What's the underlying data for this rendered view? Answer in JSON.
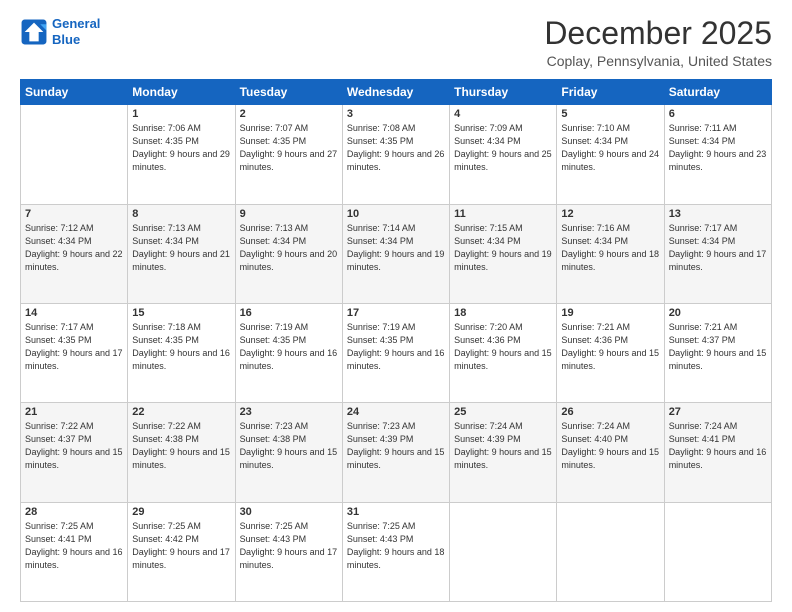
{
  "header": {
    "logo_line1": "General",
    "logo_line2": "Blue",
    "title": "December 2025",
    "subtitle": "Coplay, Pennsylvania, United States"
  },
  "weekdays": [
    "Sunday",
    "Monday",
    "Tuesday",
    "Wednesday",
    "Thursday",
    "Friday",
    "Saturday"
  ],
  "weeks": [
    [
      {
        "day": "",
        "sunrise": "",
        "sunset": "",
        "daylight": ""
      },
      {
        "day": "1",
        "sunrise": "Sunrise: 7:06 AM",
        "sunset": "Sunset: 4:35 PM",
        "daylight": "Daylight: 9 hours and 29 minutes."
      },
      {
        "day": "2",
        "sunrise": "Sunrise: 7:07 AM",
        "sunset": "Sunset: 4:35 PM",
        "daylight": "Daylight: 9 hours and 27 minutes."
      },
      {
        "day": "3",
        "sunrise": "Sunrise: 7:08 AM",
        "sunset": "Sunset: 4:35 PM",
        "daylight": "Daylight: 9 hours and 26 minutes."
      },
      {
        "day": "4",
        "sunrise": "Sunrise: 7:09 AM",
        "sunset": "Sunset: 4:34 PM",
        "daylight": "Daylight: 9 hours and 25 minutes."
      },
      {
        "day": "5",
        "sunrise": "Sunrise: 7:10 AM",
        "sunset": "Sunset: 4:34 PM",
        "daylight": "Daylight: 9 hours and 24 minutes."
      },
      {
        "day": "6",
        "sunrise": "Sunrise: 7:11 AM",
        "sunset": "Sunset: 4:34 PM",
        "daylight": "Daylight: 9 hours and 23 minutes."
      }
    ],
    [
      {
        "day": "7",
        "sunrise": "Sunrise: 7:12 AM",
        "sunset": "Sunset: 4:34 PM",
        "daylight": "Daylight: 9 hours and 22 minutes."
      },
      {
        "day": "8",
        "sunrise": "Sunrise: 7:13 AM",
        "sunset": "Sunset: 4:34 PM",
        "daylight": "Daylight: 9 hours and 21 minutes."
      },
      {
        "day": "9",
        "sunrise": "Sunrise: 7:13 AM",
        "sunset": "Sunset: 4:34 PM",
        "daylight": "Daylight: 9 hours and 20 minutes."
      },
      {
        "day": "10",
        "sunrise": "Sunrise: 7:14 AM",
        "sunset": "Sunset: 4:34 PM",
        "daylight": "Daylight: 9 hours and 19 minutes."
      },
      {
        "day": "11",
        "sunrise": "Sunrise: 7:15 AM",
        "sunset": "Sunset: 4:34 PM",
        "daylight": "Daylight: 9 hours and 19 minutes."
      },
      {
        "day": "12",
        "sunrise": "Sunrise: 7:16 AM",
        "sunset": "Sunset: 4:34 PM",
        "daylight": "Daylight: 9 hours and 18 minutes."
      },
      {
        "day": "13",
        "sunrise": "Sunrise: 7:17 AM",
        "sunset": "Sunset: 4:34 PM",
        "daylight": "Daylight: 9 hours and 17 minutes."
      }
    ],
    [
      {
        "day": "14",
        "sunrise": "Sunrise: 7:17 AM",
        "sunset": "Sunset: 4:35 PM",
        "daylight": "Daylight: 9 hours and 17 minutes."
      },
      {
        "day": "15",
        "sunrise": "Sunrise: 7:18 AM",
        "sunset": "Sunset: 4:35 PM",
        "daylight": "Daylight: 9 hours and 16 minutes."
      },
      {
        "day": "16",
        "sunrise": "Sunrise: 7:19 AM",
        "sunset": "Sunset: 4:35 PM",
        "daylight": "Daylight: 9 hours and 16 minutes."
      },
      {
        "day": "17",
        "sunrise": "Sunrise: 7:19 AM",
        "sunset": "Sunset: 4:35 PM",
        "daylight": "Daylight: 9 hours and 16 minutes."
      },
      {
        "day": "18",
        "sunrise": "Sunrise: 7:20 AM",
        "sunset": "Sunset: 4:36 PM",
        "daylight": "Daylight: 9 hours and 15 minutes."
      },
      {
        "day": "19",
        "sunrise": "Sunrise: 7:21 AM",
        "sunset": "Sunset: 4:36 PM",
        "daylight": "Daylight: 9 hours and 15 minutes."
      },
      {
        "day": "20",
        "sunrise": "Sunrise: 7:21 AM",
        "sunset": "Sunset: 4:37 PM",
        "daylight": "Daylight: 9 hours and 15 minutes."
      }
    ],
    [
      {
        "day": "21",
        "sunrise": "Sunrise: 7:22 AM",
        "sunset": "Sunset: 4:37 PM",
        "daylight": "Daylight: 9 hours and 15 minutes."
      },
      {
        "day": "22",
        "sunrise": "Sunrise: 7:22 AM",
        "sunset": "Sunset: 4:38 PM",
        "daylight": "Daylight: 9 hours and 15 minutes."
      },
      {
        "day": "23",
        "sunrise": "Sunrise: 7:23 AM",
        "sunset": "Sunset: 4:38 PM",
        "daylight": "Daylight: 9 hours and 15 minutes."
      },
      {
        "day": "24",
        "sunrise": "Sunrise: 7:23 AM",
        "sunset": "Sunset: 4:39 PM",
        "daylight": "Daylight: 9 hours and 15 minutes."
      },
      {
        "day": "25",
        "sunrise": "Sunrise: 7:24 AM",
        "sunset": "Sunset: 4:39 PM",
        "daylight": "Daylight: 9 hours and 15 minutes."
      },
      {
        "day": "26",
        "sunrise": "Sunrise: 7:24 AM",
        "sunset": "Sunset: 4:40 PM",
        "daylight": "Daylight: 9 hours and 15 minutes."
      },
      {
        "day": "27",
        "sunrise": "Sunrise: 7:24 AM",
        "sunset": "Sunset: 4:41 PM",
        "daylight": "Daylight: 9 hours and 16 minutes."
      }
    ],
    [
      {
        "day": "28",
        "sunrise": "Sunrise: 7:25 AM",
        "sunset": "Sunset: 4:41 PM",
        "daylight": "Daylight: 9 hours and 16 minutes."
      },
      {
        "day": "29",
        "sunrise": "Sunrise: 7:25 AM",
        "sunset": "Sunset: 4:42 PM",
        "daylight": "Daylight: 9 hours and 17 minutes."
      },
      {
        "day": "30",
        "sunrise": "Sunrise: 7:25 AM",
        "sunset": "Sunset: 4:43 PM",
        "daylight": "Daylight: 9 hours and 17 minutes."
      },
      {
        "day": "31",
        "sunrise": "Sunrise: 7:25 AM",
        "sunset": "Sunset: 4:43 PM",
        "daylight": "Daylight: 9 hours and 18 minutes."
      },
      {
        "day": "",
        "sunrise": "",
        "sunset": "",
        "daylight": ""
      },
      {
        "day": "",
        "sunrise": "",
        "sunset": "",
        "daylight": ""
      },
      {
        "day": "",
        "sunrise": "",
        "sunset": "",
        "daylight": ""
      }
    ]
  ]
}
